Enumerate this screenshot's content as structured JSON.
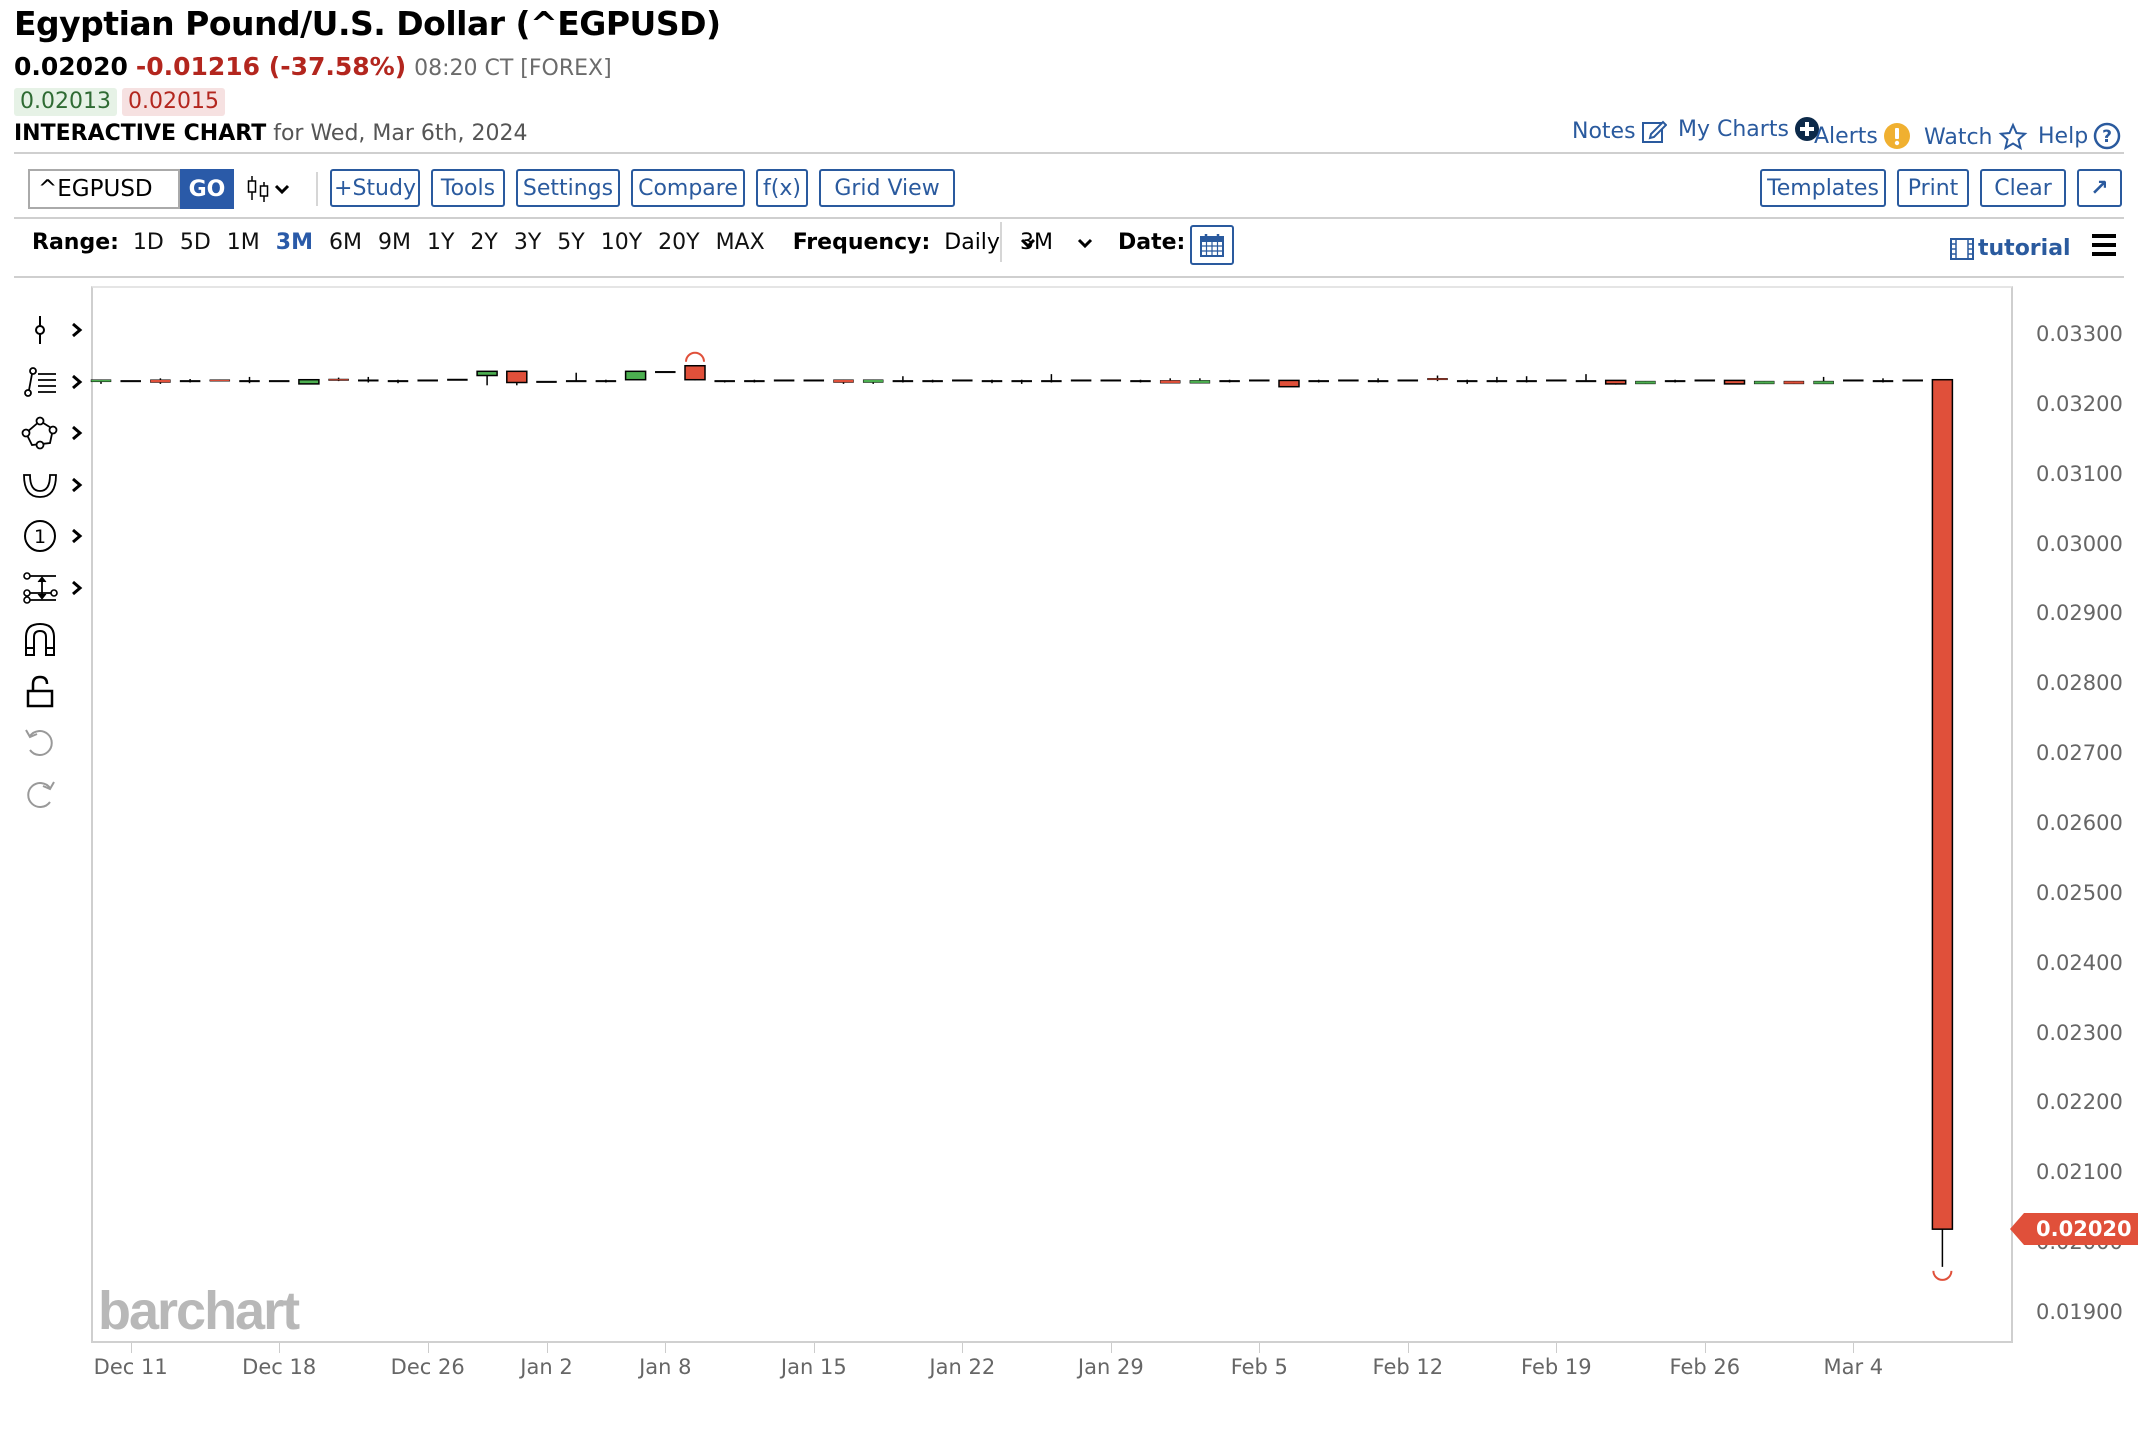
{
  "header": {
    "title": "Egyptian Pound/U.S. Dollar (^EGPUSD)",
    "last_price": "0.02020",
    "change": "-0.01216 (-37.58%)",
    "time": "08:20 CT [FOREX]",
    "bid": "0.02013",
    "ask": "0.02015",
    "chart_label": "INTERACTIVE CHART",
    "chart_date": "for Wed, Mar 6th, 2024"
  },
  "top_links": {
    "notes": "Notes",
    "my_charts": "My Charts",
    "alerts": "Alerts",
    "watch": "Watch",
    "help": "Help"
  },
  "toolbar": {
    "symbol_value": "^EGPUSD",
    "go": "GO",
    "study": "+Study",
    "tools": "Tools",
    "settings": "Settings",
    "compare": "Compare",
    "fx": "f(x)",
    "grid_view": "Grid View",
    "templates": "Templates",
    "print": "Print",
    "clear": "Clear",
    "expand": "↗"
  },
  "rangebar": {
    "range_label": "Range:",
    "ranges": [
      "1D",
      "5D",
      "1M",
      "3M",
      "6M",
      "9M",
      "1Y",
      "2Y",
      "3Y",
      "5Y",
      "10Y",
      "20Y",
      "MAX"
    ],
    "active_range": "3M",
    "frequency_label": "Frequency:",
    "frequency_value": "Daily",
    "period_value": "3M",
    "date_label": "Date:",
    "tutorial": "tutorial"
  },
  "drawing_tools": [
    {
      "name": "line-tool-icon",
      "has_menu": true
    },
    {
      "name": "fibonacci-tool-icon",
      "has_menu": true
    },
    {
      "name": "shape-tool-icon",
      "has_menu": true
    },
    {
      "name": "arc-tool-icon",
      "has_menu": true
    },
    {
      "name": "annotation-tool-icon",
      "has_menu": true
    },
    {
      "name": "measure-tool-icon",
      "has_menu": true
    },
    {
      "name": "magnet-icon",
      "has_menu": false
    },
    {
      "name": "lock-icon",
      "has_menu": false
    },
    {
      "name": "undo-icon",
      "has_menu": false
    },
    {
      "name": "redo-icon",
      "has_menu": false
    }
  ],
  "watermark": "barchart",
  "colors": {
    "up": "#4caf50",
    "down": "#e0503a",
    "accent": "#2a5aa8",
    "change_negative": "#b3261e",
    "alert": "#f0b030"
  },
  "chart_data": {
    "type": "candlestick",
    "title": "Egyptian Pound/U.S. Dollar (^EGPUSD)",
    "frequency": "Daily",
    "range": "3M",
    "ylim": [
      0.0187,
      0.0337
    ],
    "yticks": [
      "0.03300",
      "0.03200",
      "0.03100",
      "0.03000",
      "0.02900",
      "0.02800",
      "0.02700",
      "0.02600",
      "0.02500",
      "0.02400",
      "0.02300",
      "0.02200",
      "0.02100",
      "0.02000",
      "0.01900"
    ],
    "xticks": [
      {
        "label": "Dec 11",
        "index": 1
      },
      {
        "label": "Dec 18",
        "index": 6
      },
      {
        "label": "Dec 26",
        "index": 11
      },
      {
        "label": "Jan 2",
        "index": 15
      },
      {
        "label": "Jan 8",
        "index": 19
      },
      {
        "label": "Jan 15",
        "index": 24
      },
      {
        "label": "Jan 22",
        "index": 29
      },
      {
        "label": "Jan 29",
        "index": 34
      },
      {
        "label": "Feb 5",
        "index": 39
      },
      {
        "label": "Feb 12",
        "index": 44
      },
      {
        "label": "Feb 19",
        "index": 49
      },
      {
        "label": "Feb 26",
        "index": 54
      },
      {
        "label": "Mar 4",
        "index": 59
      }
    ],
    "last_price_label": "0.02020",
    "candles": [
      {
        "o": 0.03233,
        "h": 0.03236,
        "l": 0.0323,
        "c": 0.03236
      },
      {
        "o": 0.03235,
        "h": 0.03235,
        "l": 0.03235,
        "c": 0.03235
      },
      {
        "o": 0.03236,
        "h": 0.03238,
        "l": 0.0323,
        "c": 0.03232
      },
      {
        "o": 0.03235,
        "h": 0.03237,
        "l": 0.03232,
        "c": 0.03235
      },
      {
        "o": 0.03236,
        "h": 0.03236,
        "l": 0.03234,
        "c": 0.03234
      },
      {
        "o": 0.03235,
        "h": 0.0324,
        "l": 0.03231,
        "c": 0.03235
      },
      {
        "o": 0.03235,
        "h": 0.03235,
        "l": 0.03235,
        "c": 0.03235
      },
      {
        "o": 0.0323,
        "h": 0.03236,
        "l": 0.0323,
        "c": 0.03236
      },
      {
        "o": 0.03237,
        "h": 0.03239,
        "l": 0.03234,
        "c": 0.03235
      },
      {
        "o": 0.03236,
        "h": 0.0324,
        "l": 0.03232,
        "c": 0.03236
      },
      {
        "o": 0.03235,
        "h": 0.03236,
        "l": 0.03231,
        "c": 0.03235
      },
      {
        "o": 0.03236,
        "h": 0.03236,
        "l": 0.03236,
        "c": 0.03236
      },
      {
        "o": 0.03237,
        "h": 0.03237,
        "l": 0.03237,
        "c": 0.03237
      },
      {
        "o": 0.03242,
        "h": 0.03248,
        "l": 0.03228,
        "c": 0.03248
      },
      {
        "o": 0.03248,
        "h": 0.03248,
        "l": 0.03228,
        "c": 0.03232
      },
      {
        "o": 0.03234,
        "h": 0.03234,
        "l": 0.03234,
        "c": 0.03234
      },
      {
        "o": 0.03235,
        "h": 0.03246,
        "l": 0.03234,
        "c": 0.03235
      },
      {
        "o": 0.03235,
        "h": 0.03236,
        "l": 0.03232,
        "c": 0.03235
      },
      {
        "o": 0.03236,
        "h": 0.03248,
        "l": 0.03236,
        "c": 0.03248
      },
      {
        "o": 0.03248,
        "h": 0.03248,
        "l": 0.03248,
        "c": 0.03248
      },
      {
        "o": 0.03256,
        "h": 0.03256,
        "l": 0.03235,
        "c": 0.03236
      },
      {
        "o": 0.03235,
        "h": 0.03235,
        "l": 0.03232,
        "c": 0.03235
      },
      {
        "o": 0.03235,
        "h": 0.03236,
        "l": 0.03232,
        "c": 0.03235
      },
      {
        "o": 0.03236,
        "h": 0.03236,
        "l": 0.03236,
        "c": 0.03236
      },
      {
        "o": 0.03236,
        "h": 0.03236,
        "l": 0.03236,
        "c": 0.03236
      },
      {
        "o": 0.03236,
        "h": 0.03236,
        "l": 0.0323,
        "c": 0.03232
      },
      {
        "o": 0.03232,
        "h": 0.03236,
        "l": 0.0323,
        "c": 0.03236
      },
      {
        "o": 0.03235,
        "h": 0.03241,
        "l": 0.03232,
        "c": 0.03235
      },
      {
        "o": 0.03235,
        "h": 0.03236,
        "l": 0.03232,
        "c": 0.03235
      },
      {
        "o": 0.03236,
        "h": 0.03236,
        "l": 0.03236,
        "c": 0.03236
      },
      {
        "o": 0.03235,
        "h": 0.03236,
        "l": 0.03231,
        "c": 0.03235
      },
      {
        "o": 0.03235,
        "h": 0.03236,
        "l": 0.0323,
        "c": 0.03235
      },
      {
        "o": 0.03235,
        "h": 0.03244,
        "l": 0.03232,
        "c": 0.03235
      },
      {
        "o": 0.03236,
        "h": 0.03236,
        "l": 0.03236,
        "c": 0.03236
      },
      {
        "o": 0.03236,
        "h": 0.03236,
        "l": 0.03236,
        "c": 0.03236
      },
      {
        "o": 0.03235,
        "h": 0.03236,
        "l": 0.03232,
        "c": 0.03235
      },
      {
        "o": 0.03235,
        "h": 0.03238,
        "l": 0.03232,
        "c": 0.03231
      },
      {
        "o": 0.03231,
        "h": 0.03238,
        "l": 0.03231,
        "c": 0.03235
      },
      {
        "o": 0.03235,
        "h": 0.03236,
        "l": 0.03232,
        "c": 0.03235
      },
      {
        "o": 0.03236,
        "h": 0.03236,
        "l": 0.03236,
        "c": 0.03236
      },
      {
        "o": 0.03235,
        "h": 0.03235,
        "l": 0.03226,
        "c": 0.03226
      },
      {
        "o": 0.03235,
        "h": 0.03236,
        "l": 0.03232,
        "c": 0.03235
      },
      {
        "o": 0.03236,
        "h": 0.03236,
        "l": 0.03236,
        "c": 0.03236
      },
      {
        "o": 0.03235,
        "h": 0.03238,
        "l": 0.03232,
        "c": 0.03235
      },
      {
        "o": 0.03236,
        "h": 0.03236,
        "l": 0.03236,
        "c": 0.03236
      },
      {
        "o": 0.03238,
        "h": 0.03242,
        "l": 0.03234,
        "c": 0.03236
      },
      {
        "o": 0.03235,
        "h": 0.03236,
        "l": 0.0323,
        "c": 0.03235
      },
      {
        "o": 0.03235,
        "h": 0.0324,
        "l": 0.03232,
        "c": 0.03235
      },
      {
        "o": 0.03235,
        "h": 0.03241,
        "l": 0.03232,
        "c": 0.03235
      },
      {
        "o": 0.03236,
        "h": 0.03236,
        "l": 0.03236,
        "c": 0.03236
      },
      {
        "o": 0.03235,
        "h": 0.03244,
        "l": 0.03235,
        "c": 0.03235
      },
      {
        "o": 0.03235,
        "h": 0.03235,
        "l": 0.03229,
        "c": 0.0323
      },
      {
        "o": 0.0323,
        "h": 0.03234,
        "l": 0.0323,
        "c": 0.03234
      },
      {
        "o": 0.03235,
        "h": 0.03236,
        "l": 0.03232,
        "c": 0.03235
      },
      {
        "o": 0.03236,
        "h": 0.03236,
        "l": 0.03236,
        "c": 0.03236
      },
      {
        "o": 0.03235,
        "h": 0.03235,
        "l": 0.0323,
        "c": 0.0323
      },
      {
        "o": 0.0323,
        "h": 0.03234,
        "l": 0.0323,
        "c": 0.03234
      },
      {
        "o": 0.03234,
        "h": 0.03234,
        "l": 0.0323,
        "c": 0.0323
      },
      {
        "o": 0.0323,
        "h": 0.0324,
        "l": 0.0323,
        "c": 0.03234
      },
      {
        "o": 0.03236,
        "h": 0.03236,
        "l": 0.03236,
        "c": 0.03236
      },
      {
        "o": 0.03235,
        "h": 0.03238,
        "l": 0.03232,
        "c": 0.03235
      },
      {
        "o": 0.03236,
        "h": 0.03236,
        "l": 0.03236,
        "c": 0.03236
      },
      {
        "o": 0.03236,
        "h": 0.03236,
        "l": 0.01966,
        "c": 0.0202
      }
    ]
  }
}
